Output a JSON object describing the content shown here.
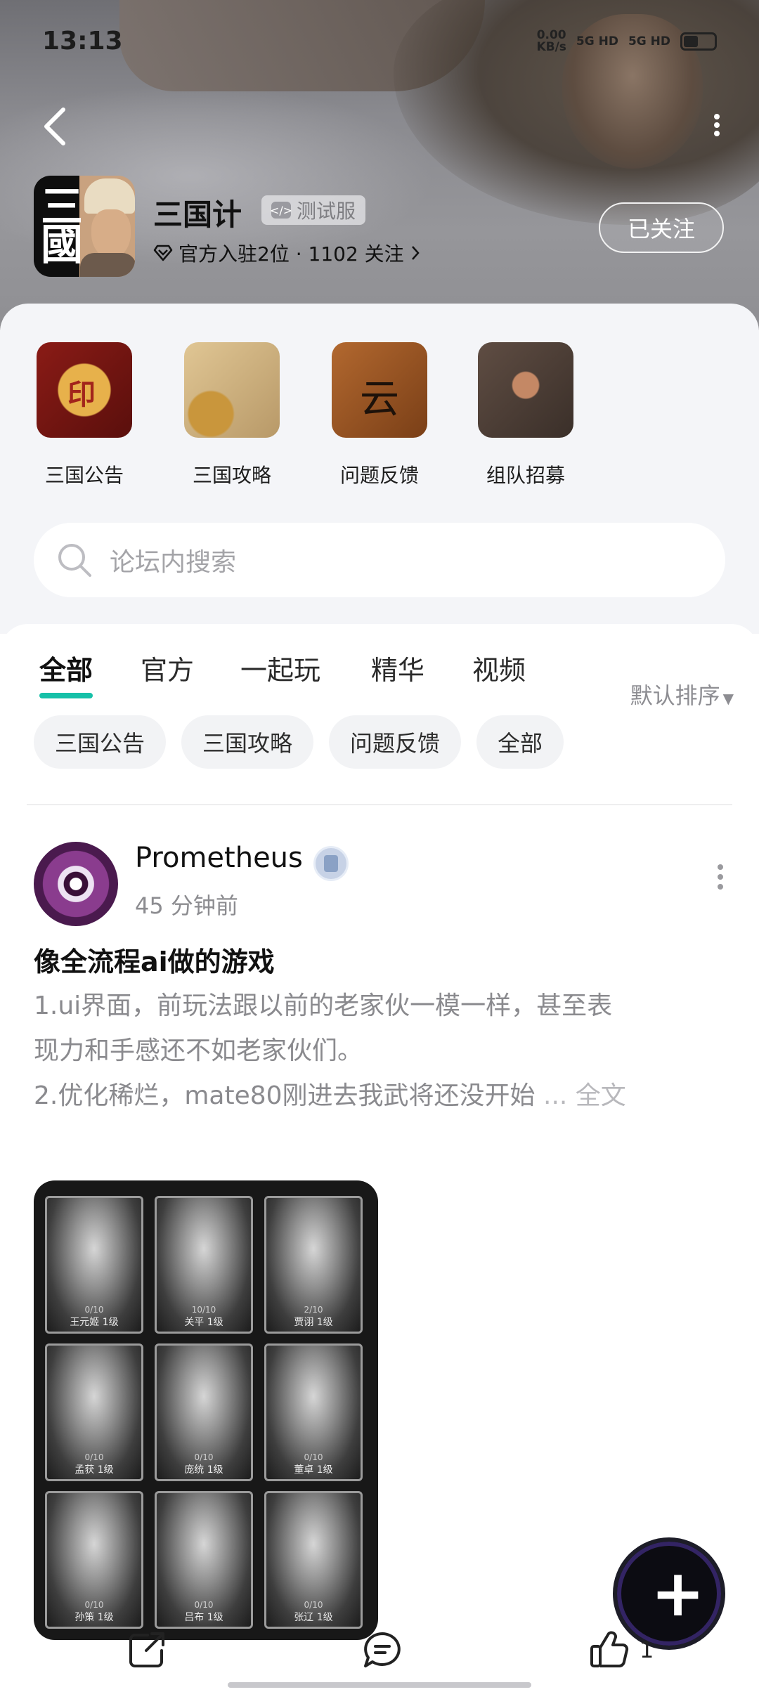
{
  "status_bar": {
    "time": "13:13",
    "net_speed": "0.00",
    "net_unit": "KB/s",
    "sim1": "5G HD",
    "sim2": "5G HD"
  },
  "header": {
    "game_title": "三国计",
    "beta_label": "测试服",
    "meta": "官方入驻2位 · 1102 关注",
    "follow_label": "已关注"
  },
  "categories": [
    {
      "label": "三国公告",
      "icon": "edict-scroll-icon"
    },
    {
      "label": "三国攻略",
      "icon": "map-compass-icon"
    },
    {
      "label": "问题反馈",
      "icon": "brush-plaque-icon"
    },
    {
      "label": "组队招募",
      "icon": "crossed-weapons-icon"
    }
  ],
  "search": {
    "placeholder": "论坛内搜索"
  },
  "tabs": [
    "全部",
    "官方",
    "一起玩",
    "精华",
    "视频"
  ],
  "active_tab": "全部",
  "sort_label": "默认排序",
  "chips": [
    "三国公告",
    "三国攻略",
    "问题反馈",
    "全部"
  ],
  "post": {
    "author": "Prometheus",
    "time": "45 分钟前",
    "title": "像全流程ai做的游戏",
    "line1": "1.ui界面，前玩法跟以前的老家伙一模一样，甚至表",
    "line2": "现力和手感还不如老家伙们。",
    "line3": "2.优化稀烂，mate80刚进去我武将还没开始",
    "ellipsis": " ... ",
    "read_more": "全文",
    "heroes": [
      {
        "name": "王元姬",
        "level": "1级",
        "stars": "0/10"
      },
      {
        "name": "关平",
        "level": "1级",
        "stars": "10/10"
      },
      {
        "name": "贾诩",
        "level": "1级",
        "stars": "2/10"
      },
      {
        "name": "孟获",
        "level": "1级",
        "stars": "0/10"
      },
      {
        "name": "庞统",
        "level": "1级",
        "stars": "0/10"
      },
      {
        "name": "董卓",
        "level": "1级",
        "stars": "0/10"
      },
      {
        "name": "孙策",
        "level": "1级",
        "stars": "0/10"
      },
      {
        "name": "吕布",
        "level": "1级",
        "stars": "0/10"
      },
      {
        "name": "张辽",
        "level": "1级",
        "stars": "0/10"
      }
    ],
    "like_count": "1"
  },
  "colors": {
    "accent": "#16c0a8",
    "panel_bg": "#f4f5f8",
    "muted_text": "#8a8a8e"
  }
}
